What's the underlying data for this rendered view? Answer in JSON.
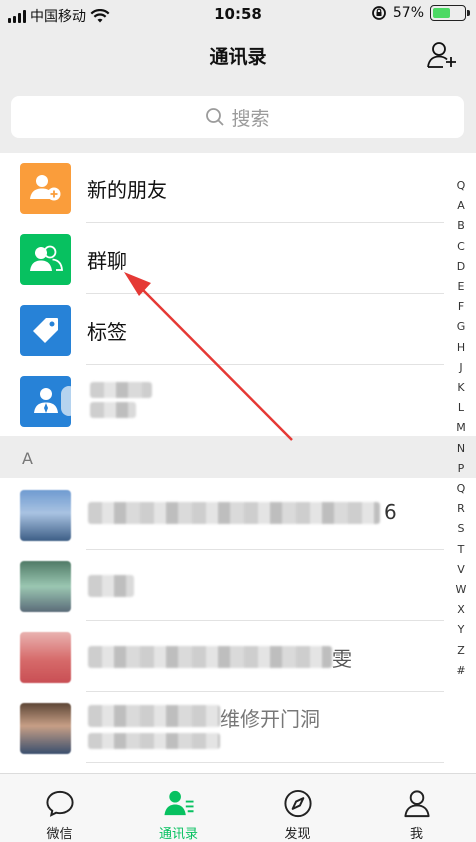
{
  "status": {
    "carrier": "中国移动",
    "time": "10:58",
    "battery": "57%",
    "battery_level": 0.57
  },
  "header": {
    "title": "通讯录"
  },
  "search": {
    "placeholder": "搜索"
  },
  "features": [
    {
      "label": "新的朋友",
      "color": "#fa9d3b",
      "icon": "new-friend-icon"
    },
    {
      "label": "群聊",
      "color": "#07c160",
      "icon": "group-chat-icon"
    },
    {
      "label": "标签",
      "color": "#2782d7",
      "icon": "tag-icon"
    }
  ],
  "section": {
    "letter": "A"
  },
  "contacts_tail": {
    "partial_char_1": "6",
    "partial_text_2": "雯",
    "partial_text_4": "维修开门洞"
  },
  "alphabet": [
    "Q",
    "A",
    "B",
    "C",
    "D",
    "E",
    "F",
    "G",
    "H",
    "J",
    "K",
    "L",
    "M",
    "N",
    "P",
    "Q",
    "R",
    "S",
    "T",
    "V",
    "W",
    "X",
    "Y",
    "Z",
    "#"
  ],
  "tabs": [
    {
      "label": "微信",
      "icon": "chat-icon",
      "active": false
    },
    {
      "label": "通讯录",
      "icon": "contacts-icon",
      "active": true
    },
    {
      "label": "发现",
      "icon": "compass-icon",
      "active": false
    },
    {
      "label": "我",
      "icon": "profile-icon",
      "active": false
    }
  ],
  "colors": {
    "accent": "#07c160",
    "annotation_arrow": "#e53935"
  }
}
